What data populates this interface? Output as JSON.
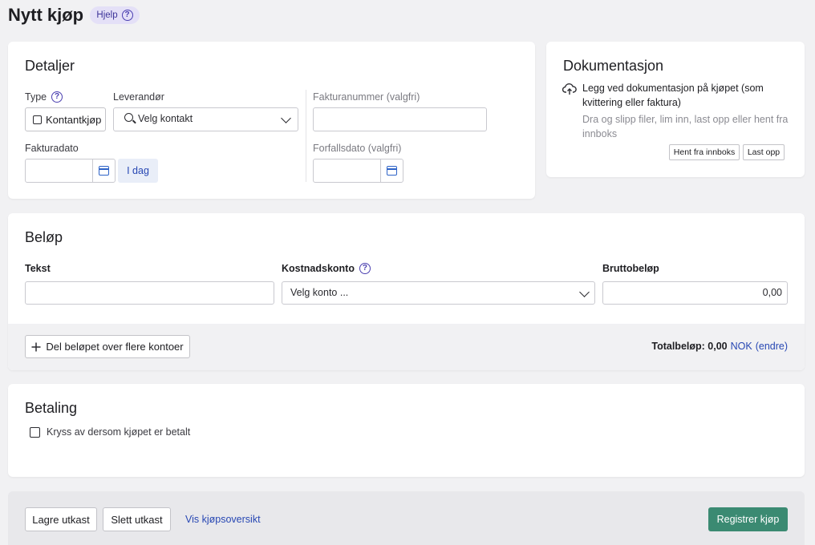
{
  "page": {
    "title": "Nytt kjøp",
    "help_label": "Hjelp"
  },
  "details": {
    "heading": "Detaljer",
    "type_label": "Type",
    "type_value": "Kontantkjøp",
    "supplier_label": "Leverandør",
    "supplier_placeholder": "Velg kontakt",
    "invoice_number_label": "Fakturanummer (valgfri)",
    "invoice_date_label": "Fakturadato",
    "today_label": "I dag",
    "due_date_label": "Forfallsdato (valgfri)"
  },
  "documentation": {
    "heading": "Dokumentasjon",
    "main_text": "Legg ved dokumentasjon på kjøpet (som kvittering eller faktura)",
    "sub_text": "Dra og slipp filer, lim inn, last opp eller hent fra innboks",
    "inbox_button": "Hent fra innboks",
    "upload_button": "Last opp"
  },
  "amount": {
    "heading": "Beløp",
    "text_label": "Tekst",
    "account_label": "Kostnadskonto",
    "account_placeholder": "Velg konto ...",
    "gross_label": "Bruttobeløp",
    "gross_value": "0,00",
    "split_button": "Del beløpet over flere kontoer",
    "total_label": "Totalbeløp: 0,00",
    "currency": "NOK",
    "change_link": "(endre)"
  },
  "payment": {
    "heading": "Betaling",
    "paid_checkbox_label": "Kryss av dersom kjøpet er betalt"
  },
  "footer": {
    "save_draft": "Lagre utkast",
    "delete_draft": "Slett utkast",
    "overview_link": "Vis kjøpsoversikt",
    "register_button": "Registrer kjøp"
  },
  "colors": {
    "primary_green": "#3b8a72",
    "link_blue": "#2747b3",
    "help_badge_bg": "#e4e0f7"
  },
  "icons": [
    "question-icon",
    "checkbox-icon",
    "search-icon",
    "chevron-down-icon",
    "calendar-icon",
    "upload-cloud-icon",
    "plus-icon"
  ]
}
